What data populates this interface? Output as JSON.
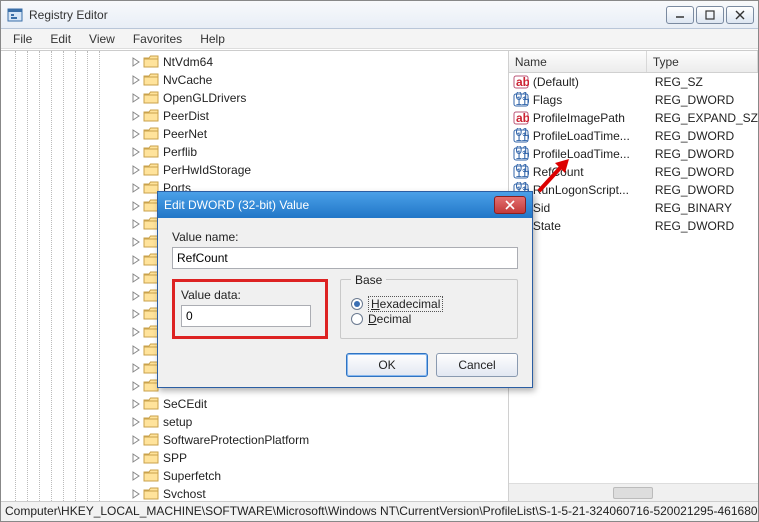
{
  "window": {
    "title": "Registry Editor",
    "menu": [
      "File",
      "Edit",
      "View",
      "Favorites",
      "Help"
    ]
  },
  "tree": {
    "items": [
      "NtVdm64",
      "NvCache",
      "OpenGLDrivers",
      "PeerDist",
      "PeerNet",
      "Perflib",
      "PerHwIdStorage",
      "Ports",
      "",
      "",
      "",
      "",
      "",
      "",
      "",
      "",
      "",
      "",
      "",
      "SeCEdit",
      "setup",
      "SoftwareProtectionPlatform",
      "SPP",
      "Superfetch",
      "Svchost"
    ]
  },
  "list": {
    "headers": {
      "name": "Name",
      "type": "Type"
    },
    "rows": [
      {
        "icon": "string",
        "name": "(Default)",
        "type": "REG_SZ"
      },
      {
        "icon": "dword",
        "name": "Flags",
        "type": "REG_DWORD"
      },
      {
        "icon": "string",
        "name": "ProfileImagePath",
        "type": "REG_EXPAND_SZ"
      },
      {
        "icon": "dword",
        "name": "ProfileLoadTime...",
        "type": "REG_DWORD"
      },
      {
        "icon": "dword",
        "name": "ProfileLoadTime...",
        "type": "REG_DWORD"
      },
      {
        "icon": "dword",
        "name": "RefCount",
        "type": "REG_DWORD"
      },
      {
        "icon": "dword",
        "name": "RunLogonScript...",
        "type": "REG_DWORD"
      },
      {
        "icon": "dword",
        "name": "Sid",
        "type": "REG_BINARY"
      },
      {
        "icon": "dword",
        "name": "State",
        "type": "REG_DWORD"
      }
    ]
  },
  "statusbar": "Computer\\HKEY_LOCAL_MACHINE\\SOFTWARE\\Microsoft\\Windows NT\\CurrentVersion\\ProfileList\\S-1-5-21-324060716-520021295-461680",
  "dialog": {
    "title": "Edit DWORD (32-bit) Value",
    "valueNameLabel": "Value name:",
    "valueName": "RefCount",
    "valueDataLabel": "Value data:",
    "valueData": "0",
    "baseLabel": "Base",
    "hex": "Hexadecimal",
    "dec": "Decimal",
    "ok": "OK",
    "cancel": "Cancel"
  }
}
